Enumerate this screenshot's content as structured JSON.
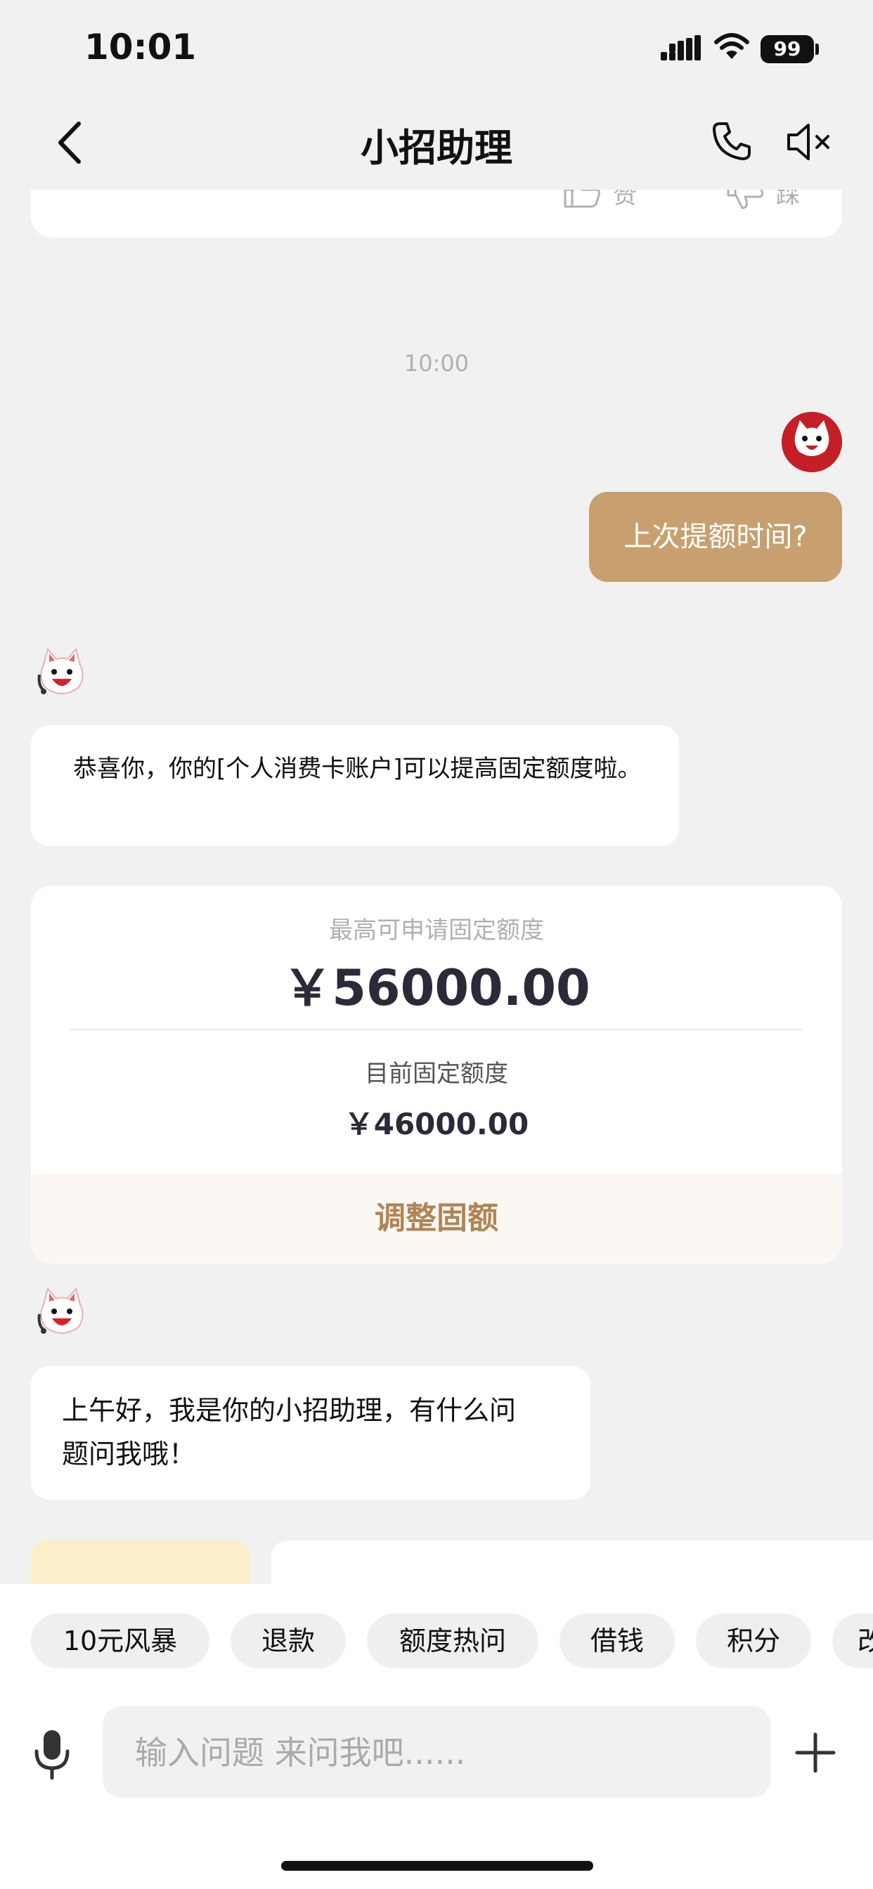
{
  "status_bar": {
    "time": "10:01",
    "battery": "99"
  },
  "nav": {
    "title": "小招助理"
  },
  "previous_card": {
    "like_label": "赞",
    "dislike_label": "踩"
  },
  "timestamp": "10:00",
  "user_message": "上次提额时间?",
  "bot_message_1": "恭喜你，你的[个人消费卡账户]可以提高固定额度啦。",
  "limit_card": {
    "max_label": "最高可申请固定额度",
    "max_value": "￥56000.00",
    "current_label": "目前固定额度",
    "current_value": "￥46000.00",
    "action_label": "调整固额"
  },
  "bot_message_2_line1": "上午好，我是你的小招助理，有什么问",
  "bot_message_2_line2": "题问我哦！",
  "quick_chips": [
    "10元风暴",
    "退款",
    "额度热问",
    "借钱",
    "积分",
    "改"
  ],
  "input": {
    "placeholder": "输入问题 来问我吧......"
  },
  "colors": {
    "accent": "#c8a06f",
    "action_text": "#b08555",
    "background": "#f1f1f1"
  }
}
